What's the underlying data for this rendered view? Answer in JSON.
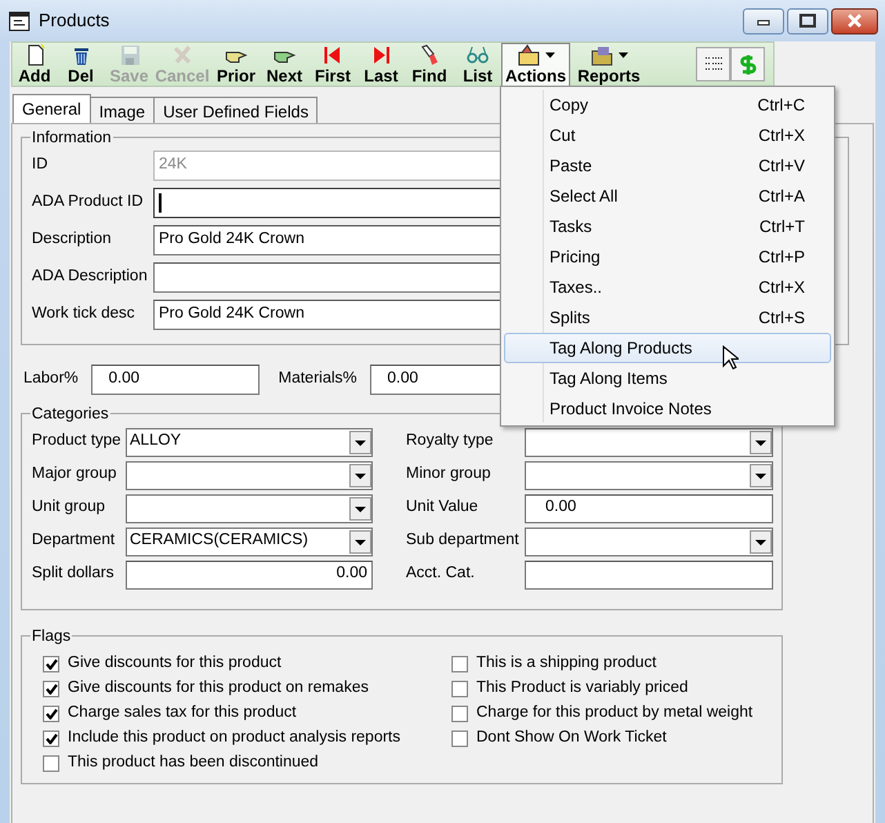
{
  "window": {
    "title": "Products"
  },
  "toolbar": [
    {
      "kind": "tool",
      "label": "Add",
      "disabled": false,
      "pressed": false
    },
    {
      "kind": "tool",
      "label": "Del",
      "disabled": false,
      "pressed": false
    },
    {
      "kind": "tool",
      "label": "Save",
      "disabled": true,
      "pressed": false
    },
    {
      "kind": "tool",
      "label": "Cancel",
      "disabled": true,
      "pressed": false
    },
    {
      "kind": "tool",
      "label": "Prior",
      "disabled": false,
      "pressed": false
    },
    {
      "kind": "tool",
      "label": "Next",
      "disabled": false,
      "pressed": false
    },
    {
      "kind": "tool",
      "label": "First",
      "disabled": false,
      "pressed": false
    },
    {
      "kind": "tool",
      "label": "Last",
      "disabled": false,
      "pressed": false
    },
    {
      "kind": "tool",
      "label": "Find",
      "disabled": false,
      "pressed": false
    },
    {
      "kind": "tool",
      "label": "List",
      "disabled": false,
      "pressed": false
    },
    {
      "kind": "dropdown",
      "label": "Actions",
      "disabled": false,
      "pressed": true
    },
    {
      "kind": "dropdown",
      "label": "Reports",
      "disabled": false,
      "pressed": false
    },
    {
      "kind": "icon",
      "disabled": false,
      "pressed": false
    },
    {
      "kind": "icon",
      "disabled": false,
      "pressed": false
    }
  ],
  "tabs": [
    {
      "label": "General",
      "selected": true
    },
    {
      "label": "Image",
      "selected": false
    },
    {
      "label": "User Defined Fields",
      "selected": false
    }
  ],
  "information": {
    "title": "Information",
    "fields": [
      {
        "label": "ID",
        "value": "24K",
        "disabled": true,
        "focused": false
      },
      {
        "label": "ADA Product ID",
        "disabled": false,
        "focused": true
      },
      {
        "label": "Description",
        "value": "Pro Gold 24K Crown",
        "disabled": false,
        "focused": false
      },
      {
        "label": "ADA Description",
        "disabled": false,
        "focused": false
      },
      {
        "label": "Work tick desc",
        "value": "Pro Gold 24K Crown",
        "disabled": false,
        "focused": false
      }
    ]
  },
  "rates": [
    {
      "label": "Labor%",
      "value": "0.00"
    },
    {
      "label": "Materials%",
      "value": "0.00"
    }
  ],
  "categories": {
    "title": "Categories",
    "fields": [
      {
        "kind": "combo",
        "label": "Product type",
        "value": "ALLOY"
      },
      {
        "kind": "combo",
        "label": "Royalty type"
      },
      {
        "kind": "combo",
        "label": "Major group"
      },
      {
        "kind": "combo",
        "label": "Minor group"
      },
      {
        "kind": "combo",
        "label": "Unit group"
      },
      {
        "kind": "text",
        "label": "Unit Value",
        "value": "0.00"
      },
      {
        "kind": "combo",
        "label": "Department",
        "value": "CERAMICS(CERAMICS)"
      },
      {
        "kind": "combo",
        "label": "Sub department"
      },
      {
        "kind": "amount",
        "label": "Split dollars",
        "value": "0.00"
      },
      {
        "kind": "text",
        "label": "Acct. Cat."
      }
    ]
  },
  "flags": {
    "title": "Flags",
    "columns": [
      [
        {
          "label": "Give discounts for this product",
          "checked": true
        },
        {
          "label": "Give discounts for this product on remakes",
          "checked": true
        },
        {
          "label": "Charge sales tax for this product",
          "checked": true
        },
        {
          "label": "Include this product on product analysis reports",
          "checked": true
        },
        {
          "label": "This product has been discontinued",
          "checked": false
        }
      ],
      [
        {
          "label": "This is a shipping product",
          "checked": false
        },
        {
          "label": "This Product is variably priced",
          "checked": false
        },
        {
          "label": "Charge for this product by metal weight",
          "checked": false
        },
        {
          "label": "Dont Show On Work Ticket",
          "checked": false
        }
      ]
    ]
  },
  "menu": {
    "items": [
      {
        "label": "Copy",
        "shortcut": "Ctrl+C",
        "selected": false
      },
      {
        "label": "Cut",
        "shortcut": "Ctrl+X",
        "selected": false
      },
      {
        "label": "Paste",
        "shortcut": "Ctrl+V",
        "selected": false
      },
      {
        "label": "Select All",
        "shortcut": "Ctrl+A",
        "selected": false
      },
      {
        "label": "Tasks",
        "shortcut": "Ctrl+T",
        "selected": false
      },
      {
        "label": "Pricing",
        "shortcut": "Ctrl+P",
        "selected": false
      },
      {
        "label": "Taxes..",
        "shortcut": "Ctrl+X",
        "selected": false
      },
      {
        "label": "Splits",
        "shortcut": "Ctrl+S",
        "selected": false
      },
      {
        "label": "Tag Along Products",
        "selected": true
      },
      {
        "label": "Tag Along Items",
        "selected": false
      },
      {
        "label": "Product Invoice Notes",
        "selected": false
      }
    ]
  }
}
